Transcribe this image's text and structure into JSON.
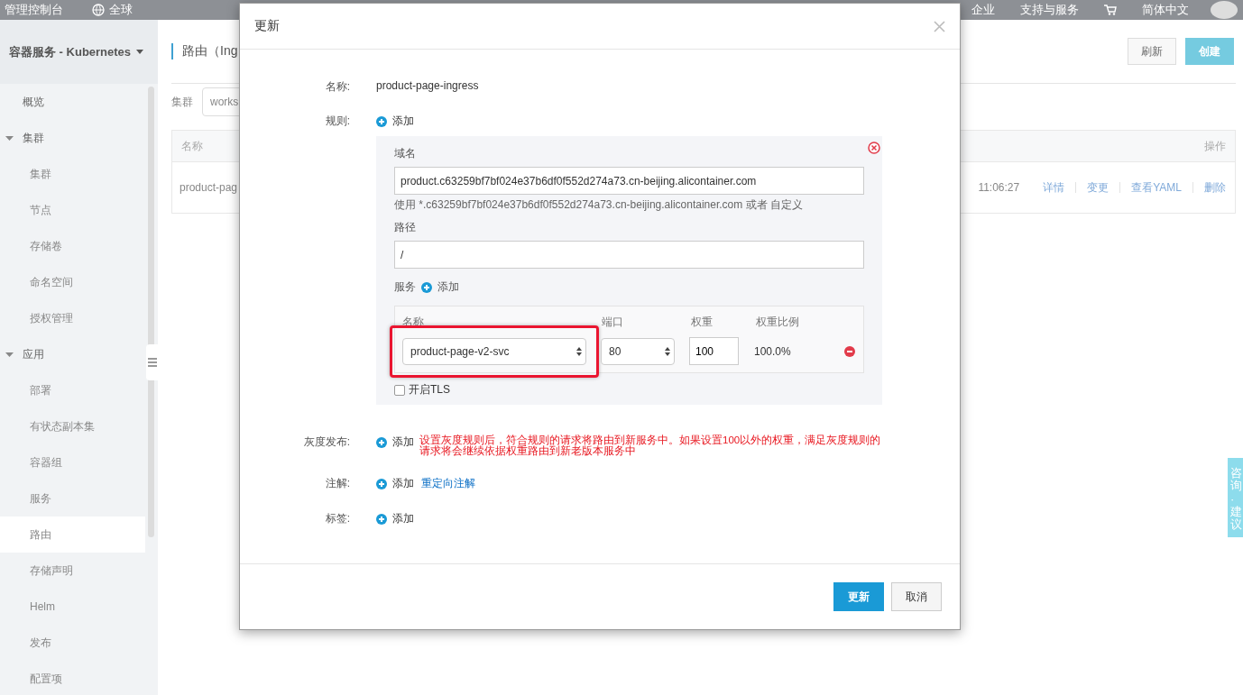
{
  "top_bar": {
    "console": "管理控制台",
    "region": "全球",
    "links": [
      "企业",
      "支持与服务"
    ],
    "language": "简体中文"
  },
  "sidebar": {
    "title": "容器服务 - Kubernetes",
    "items": [
      {
        "label": "概览",
        "selected": false
      },
      {
        "label": "集群",
        "expanded": true,
        "selected": false,
        "children": [
          {
            "label": "集群",
            "selected": false
          },
          {
            "label": "节点",
            "selected": false
          },
          {
            "label": "存储卷",
            "selected": false
          },
          {
            "label": "命名空间",
            "selected": false
          },
          {
            "label": "授权管理",
            "selected": false
          }
        ]
      },
      {
        "label": "应用",
        "expanded": true,
        "selected": false,
        "children": [
          {
            "label": "部署",
            "selected": false
          },
          {
            "label": "有状态副本集",
            "selected": false
          },
          {
            "label": "容器组",
            "selected": false
          },
          {
            "label": "服务",
            "selected": false
          },
          {
            "label": "路由",
            "selected": true
          },
          {
            "label": "存储声明",
            "selected": false
          },
          {
            "label": "Helm",
            "selected": false
          },
          {
            "label": "发布",
            "selected": false
          },
          {
            "label": "配置项",
            "selected": false
          }
        ]
      }
    ]
  },
  "page": {
    "title": "路由（Ing",
    "buttons": [
      "刷新",
      "创建"
    ],
    "filter": {
      "label": "集群",
      "value": "works"
    },
    "table": {
      "columns": [
        "名称",
        "操作"
      ],
      "rows": [
        {
          "name": "product-pag",
          "time": "11:06:27",
          "actions": [
            "详情",
            "变更",
            "查看YAML",
            "删除"
          ]
        }
      ]
    }
  },
  "dialog": {
    "title": "更新",
    "name_label": "名称:",
    "name": "product-page-ingress",
    "rules_label": "规则:",
    "add": "添加",
    "rule": {
      "domain_label": "域名",
      "domain": "product.c63259bf7bf024e37b6df0f552d274a73.cn-beijing.alicontainer.com",
      "hint": "使用 *.c63259bf7bf024e37b6df0f552d274a73.cn-beijing.alicontainer.com 或者 自定义",
      "path_label": "路径",
      "path": "/",
      "services_label": "服务",
      "services_add": "添加",
      "columns": [
        "名称",
        "端口",
        "权重",
        "权重比例"
      ],
      "services": [
        {
          "name": "product-page-v2-svc",
          "port": "80",
          "weight": "100",
          "ratio": "100.0%",
          "highlighted": true
        }
      ],
      "tls": {
        "label": "开启TLS",
        "checked": false
      }
    },
    "canary_label": "灰度发布:",
    "canary_add": "添加",
    "canary_note": "设置灰度规则后，符合规则的请求将路由到新服务中。如果设置100以外的权重，满足灰度规则的请求将会继续依据权重路由到新老版本服务中",
    "annotations_label": "注解:",
    "annotations_add": "添加",
    "annotations_link": "重定向注解",
    "labels_label": "标签:",
    "labels_add": "添加",
    "buttons": [
      {
        "label": "更新",
        "kind": "primary"
      },
      {
        "label": "取消",
        "kind": "default"
      }
    ]
  },
  "feedback_tab": "咨询·建议"
}
